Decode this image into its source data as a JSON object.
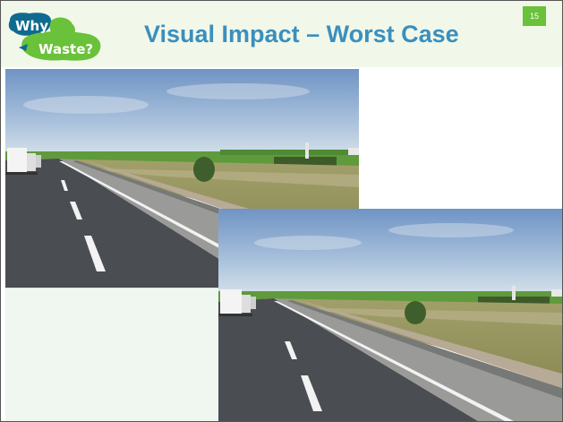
{
  "slide": {
    "title": "Visual Impact – Worst Case",
    "page_number": "15"
  },
  "logo": {
    "line1": "Why",
    "line2": "Waste?",
    "color_dark": "#0f5a7a",
    "color_green": "#6ac13a"
  },
  "photos": [
    {
      "description_name": "highway-roadside-photo-large"
    },
    {
      "description_name": "highway-roadside-photo-small"
    }
  ],
  "colors": {
    "title": "#3b8fbd",
    "header_bg": "#f1f8ea",
    "badge_bg": "#6ac13a"
  }
}
